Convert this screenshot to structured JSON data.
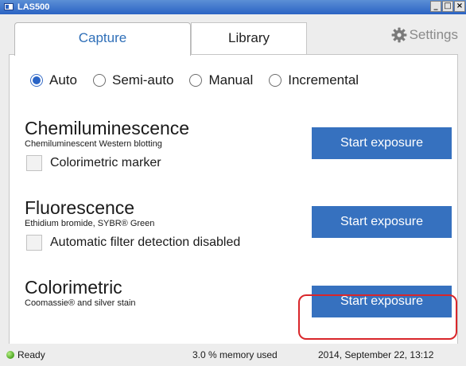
{
  "window": {
    "title": "LAS500",
    "minimize": "_",
    "maximize": "□",
    "close": "×"
  },
  "tabs": [
    {
      "label": "Capture",
      "active": true
    },
    {
      "label": "Library",
      "active": false
    }
  ],
  "settings": {
    "label": "Settings",
    "icon": "gear-icon"
  },
  "modes": [
    {
      "label": "Auto",
      "selected": true
    },
    {
      "label": "Semi-auto",
      "selected": false
    },
    {
      "label": "Manual",
      "selected": false
    },
    {
      "label": "Incremental",
      "selected": false
    }
  ],
  "sections": [
    {
      "title": "Chemiluminescence",
      "subtitle": "Chemiluminescent Western blotting",
      "checkbox_label": "Colorimetric marker",
      "button_label": "Start exposure"
    },
    {
      "title": "Fluorescence",
      "subtitle": "Ethidium bromide, SYBR® Green",
      "checkbox_label": "Automatic filter detection disabled",
      "button_label": "Start exposure"
    },
    {
      "title": "Colorimetric",
      "subtitle": "Coomassie® and silver stain",
      "button_label": "Start exposure",
      "highlighted": true
    }
  ],
  "status": {
    "state": "Ready",
    "memory": "3.0 % memory used",
    "datetime": "2014, September 22, 13:12"
  },
  "colors": {
    "accent": "#3671bf",
    "tab_active_text": "#2f6fb8",
    "highlight_ring": "#d9262a",
    "status_ok": "#4aa51f"
  }
}
